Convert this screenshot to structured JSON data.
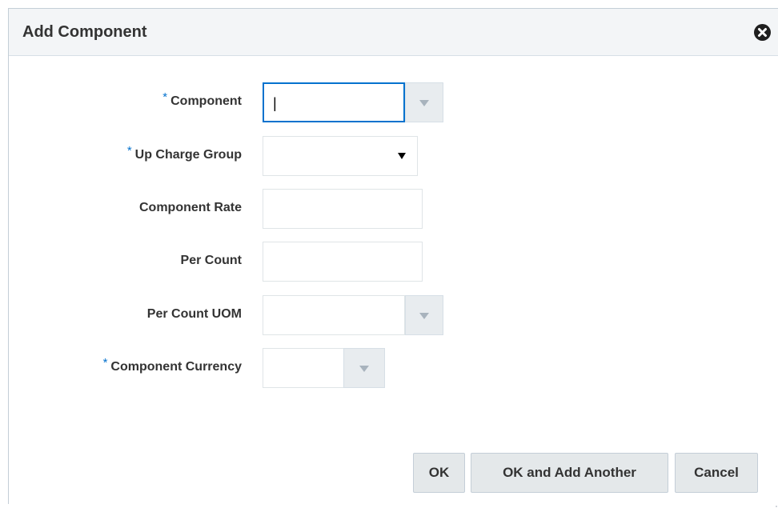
{
  "dialog": {
    "title": "Add Component"
  },
  "form": {
    "required_marker": "*",
    "component": {
      "label": "Component",
      "value": ""
    },
    "up_charge_group": {
      "label": "Up Charge Group",
      "value": ""
    },
    "component_rate": {
      "label": "Component Rate",
      "value": ""
    },
    "per_count": {
      "label": "Per Count",
      "value": ""
    },
    "per_count_uom": {
      "label": "Per Count UOM",
      "value": ""
    },
    "component_currency": {
      "label": "Component Currency",
      "value": ""
    }
  },
  "buttons": {
    "ok": "OK",
    "ok_add_another": "OK and Add Another",
    "cancel": "Cancel"
  },
  "colors": {
    "required": "#0572ce",
    "focus_border": "#0572ce",
    "header_bg": "#f3f5f7",
    "button_bg": "#e4e8ea"
  }
}
